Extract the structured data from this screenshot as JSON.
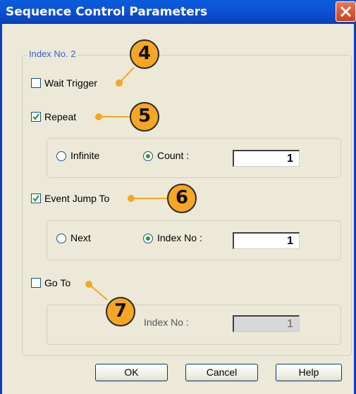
{
  "window": {
    "title": "Sequence Control Parameters"
  },
  "group_label": "Index No. 2",
  "wait_trigger": {
    "label": "Wait Trigger",
    "checked": false
  },
  "repeat": {
    "label": "Repeat",
    "checked": true,
    "option_infinite": "Infinite",
    "option_count": "Count :",
    "selected": "Count :",
    "value": "1"
  },
  "event_jump": {
    "label": "Event Jump To",
    "checked": true,
    "option_next": "Next",
    "option_index": "Index No :",
    "selected": "Index No :",
    "value": "1"
  },
  "goto": {
    "label": "Go To",
    "checked": false,
    "index_label": "Index No :",
    "value": "1"
  },
  "callouts": [
    "4",
    "5",
    "6",
    "7"
  ],
  "buttons": {
    "ok": "OK",
    "cancel": "Cancel",
    "help": "Help"
  },
  "colors": {
    "callout": "#f5a623",
    "title_bar": "#0d52d6",
    "radio_dot": "#21a121",
    "check": "#21a121"
  }
}
